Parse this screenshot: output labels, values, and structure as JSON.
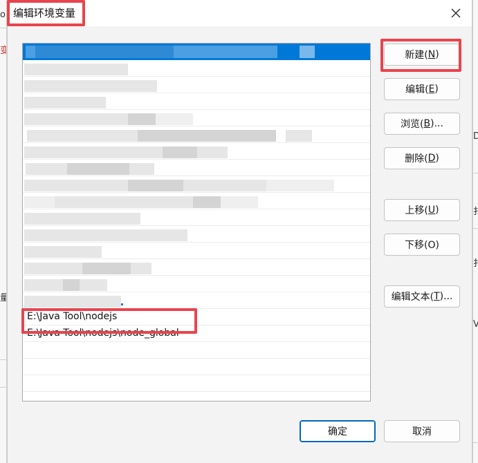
{
  "dialog": {
    "title": "编辑环境变量"
  },
  "list": {
    "rows": [
      "",
      "",
      "",
      "",
      "",
      "",
      "",
      "",
      "",
      "",
      "",
      "",
      "",
      "",
      "",
      "",
      "E:\\Java Tool\\nodejs",
      "E:\\Java Tool\\nodejs\\node_global"
    ]
  },
  "buttons": {
    "new": {
      "label": "新建(",
      "key": "N",
      "end": ")"
    },
    "edit": {
      "label": "编辑(",
      "key": "E",
      "end": ")"
    },
    "browse": {
      "label": "浏览(",
      "key": "B",
      "end": ")..."
    },
    "delete": {
      "label": "删除(",
      "key": "D",
      "end": ")"
    },
    "move_up": {
      "label": "上移(",
      "key": "U",
      "end": ")"
    },
    "move_down": {
      "label": "下移(O)"
    },
    "edit_text": {
      "label": "编辑文本(",
      "key": "T",
      "end": ")..."
    },
    "ok": "确定",
    "cancel": "取消"
  },
  "background": {
    "left_fragments": [
      "o",
      "变",
      "量"
    ],
    "right_fragments": [
      "D",
      "扌",
      "扌",
      "V"
    ]
  },
  "colors": {
    "accent": "#0078d7",
    "highlight": "#e8444d"
  }
}
